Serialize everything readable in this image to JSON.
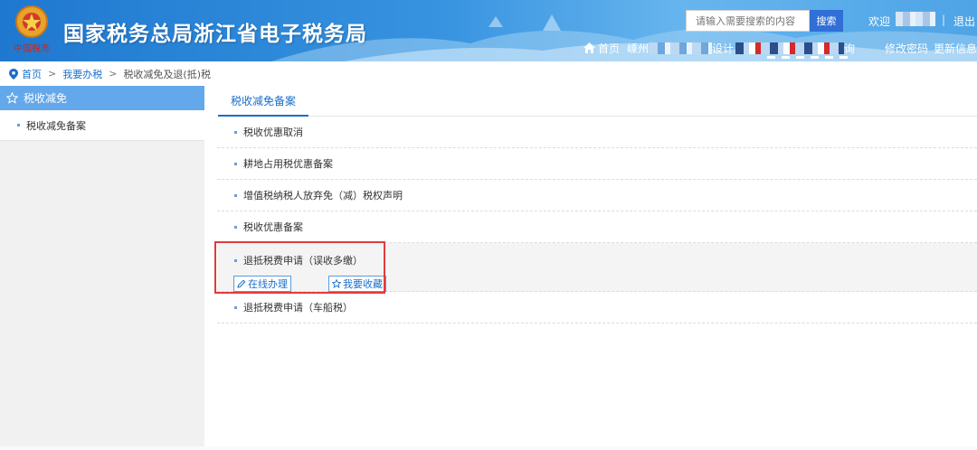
{
  "header": {
    "site_title": "国家税务总局浙江省电子税务局",
    "emblem_text": "中国税务",
    "search": {
      "placeholder": "请输入需要搜索的内容",
      "button_label": "搜索"
    },
    "welcome": "欢迎",
    "logout": "退出",
    "nav": {
      "home": "首页",
      "partial_item": "嵊州",
      "partial_item2": "设计",
      "partial_item3": "询",
      "change_password": "修改密码",
      "update_info": "更新信息"
    }
  },
  "breadcrumb": {
    "home": "首页",
    "section": "我要办税",
    "current": "税收减免及退(抵)税"
  },
  "sidebar": {
    "header": "税收减免",
    "items": [
      {
        "label": "税收减免备案"
      }
    ]
  },
  "main": {
    "tabs": [
      {
        "label": "税收减免备案",
        "active": true
      }
    ],
    "rows": [
      {
        "label": "税收优惠取消"
      },
      {
        "label": "耕地占用税优惠备案"
      },
      {
        "label": "增值税纳税人放弃免（减）税权声明"
      },
      {
        "label": "税收优惠备案"
      },
      {
        "label": "退抵税费申请（误收多缴）",
        "expanded": true,
        "actions": {
          "online": "在线办理",
          "favorite": "我要收藏"
        }
      },
      {
        "label": "退抵税费申请（车船税）"
      }
    ]
  },
  "colors": {
    "header_blue": "#2a86d8",
    "sidebar_active": "#63a8ea",
    "link_blue": "#1a6fc9",
    "highlight_red": "#e23b3b"
  },
  "icons": [
    "emblem-icon",
    "home-icon",
    "location-pin-icon",
    "star-outline-icon",
    "edit-pencil-icon",
    "favorite-star-icon"
  ]
}
